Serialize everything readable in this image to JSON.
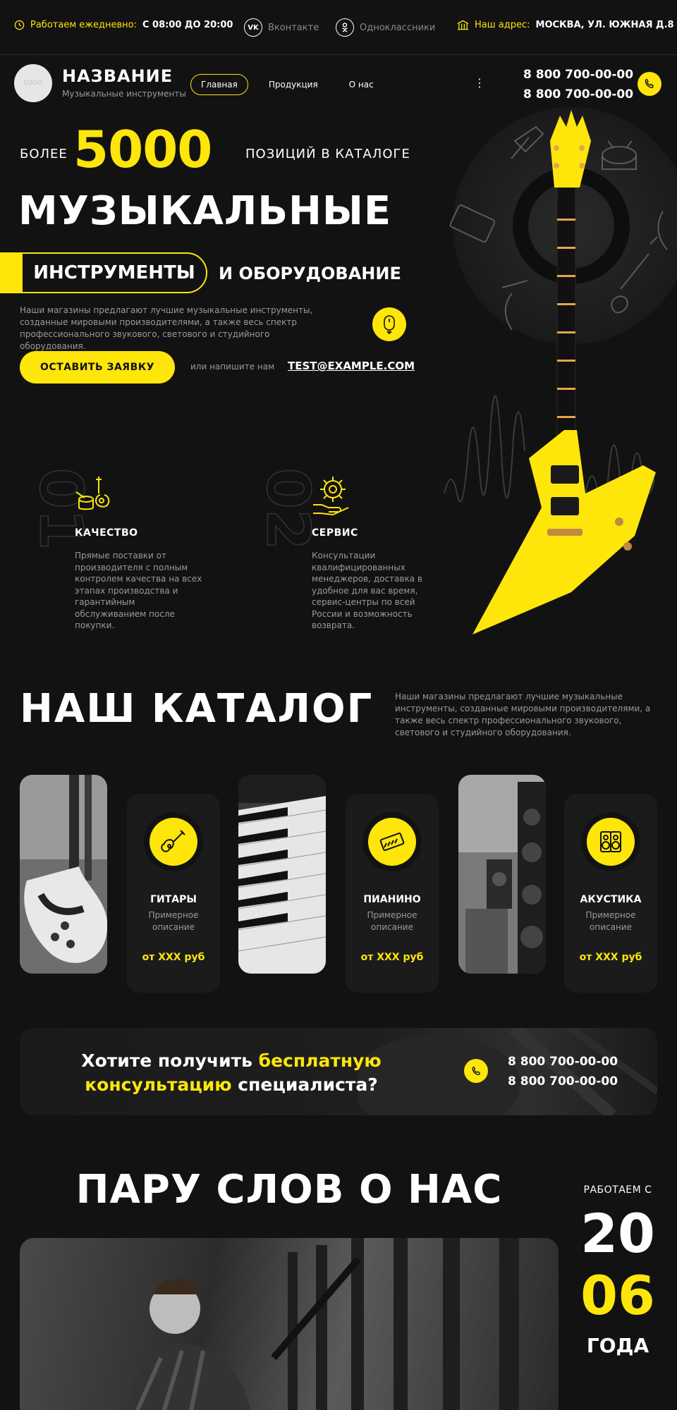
{
  "topbar": {
    "hours_label": "Работаем ежедневно:",
    "hours_value": "С 08:00 ДО 20:00",
    "vk_icon": "VK",
    "vk_label": "Вконтакте",
    "ok_label": "Одноклассники",
    "address_label": "Наш адрес:",
    "address_value": "МОСКВА, УЛ. ЮЖНАЯ Д.8"
  },
  "header": {
    "logo_text": "LOGO",
    "brand_name": "НАЗВАНИЕ",
    "brand_sub": "Музыкальные инструменты",
    "nav": [
      {
        "label": "Главная",
        "active": true
      },
      {
        "label": "Продукция",
        "active": false
      },
      {
        "label": "О нас",
        "active": false
      }
    ],
    "menu_dots": "⋮",
    "phone1": "8 800 700-00-00",
    "phone2": "8 800 700-00-00"
  },
  "hero": {
    "pre": "БОЛЕЕ",
    "number": "5000",
    "post": "ПОЗИЦИЙ В КАТАЛОГЕ",
    "title": "МУЗЫКАЛЬНЫЕ",
    "title_pill": "ИНСТРУМЕНТЫ",
    "title_rest": "И ОБОРУДОВАНИЕ",
    "description": "Наши магазины предлагают лучшие музыкальные инструменты, созданные мировыми производителями, а также весь спектр профессионального звукового, светового и студийного оборудования.",
    "cta": "ОСТАВИТЬ ЗАЯВКУ",
    "or_write": "или напишите нам",
    "email": "TEST@EXAMPLE.COM"
  },
  "features": [
    {
      "num": "01",
      "title": "КАЧЕСТВО",
      "text": "Прямые поставки от производителя с полным контролем качества на всех этапах производства и гарантийным обслуживанием после покупки."
    },
    {
      "num": "02",
      "title": "СЕРВИС",
      "text": "Консультации квалифицированных менеджеров, доставка в удобное для вас время, сервис-центры по всей России и возможность возврата."
    }
  ],
  "catalog": {
    "title": "НАШ КАТАЛОГ",
    "description": "Наши магазины предлагают лучшие музыкальные инструменты, созданные мировыми производителями, а также весь спектр профессионального звукового, светового и студийного оборудования.",
    "items": [
      {
        "title": "ГИТАРЫ",
        "desc": "Примерное описание",
        "price": "от XXX руб"
      },
      {
        "title": "ПИАНИНО",
        "desc": "Примерное описание",
        "price": "от XXX руб"
      },
      {
        "title": "АКУСТИКА",
        "desc": "Примерное описание",
        "price": "от XXX руб"
      }
    ]
  },
  "consult": {
    "q1": "Хотите получить ",
    "q1_hl": "бесплатную",
    "q2_hl": "консультацию",
    "q2": " специалиста?",
    "phone1": "8 800 700-00-00",
    "phone2": "8 800 700-00-00"
  },
  "about": {
    "title": "ПАРУ СЛОВ О НАС",
    "since_label": "РАБОТАЕМ С",
    "year1": "20",
    "year2": "06",
    "since_post": "ГОДА"
  },
  "colors": {
    "accent": "#FFE60A",
    "bg": "#121212",
    "card": "#1b1b1b"
  }
}
